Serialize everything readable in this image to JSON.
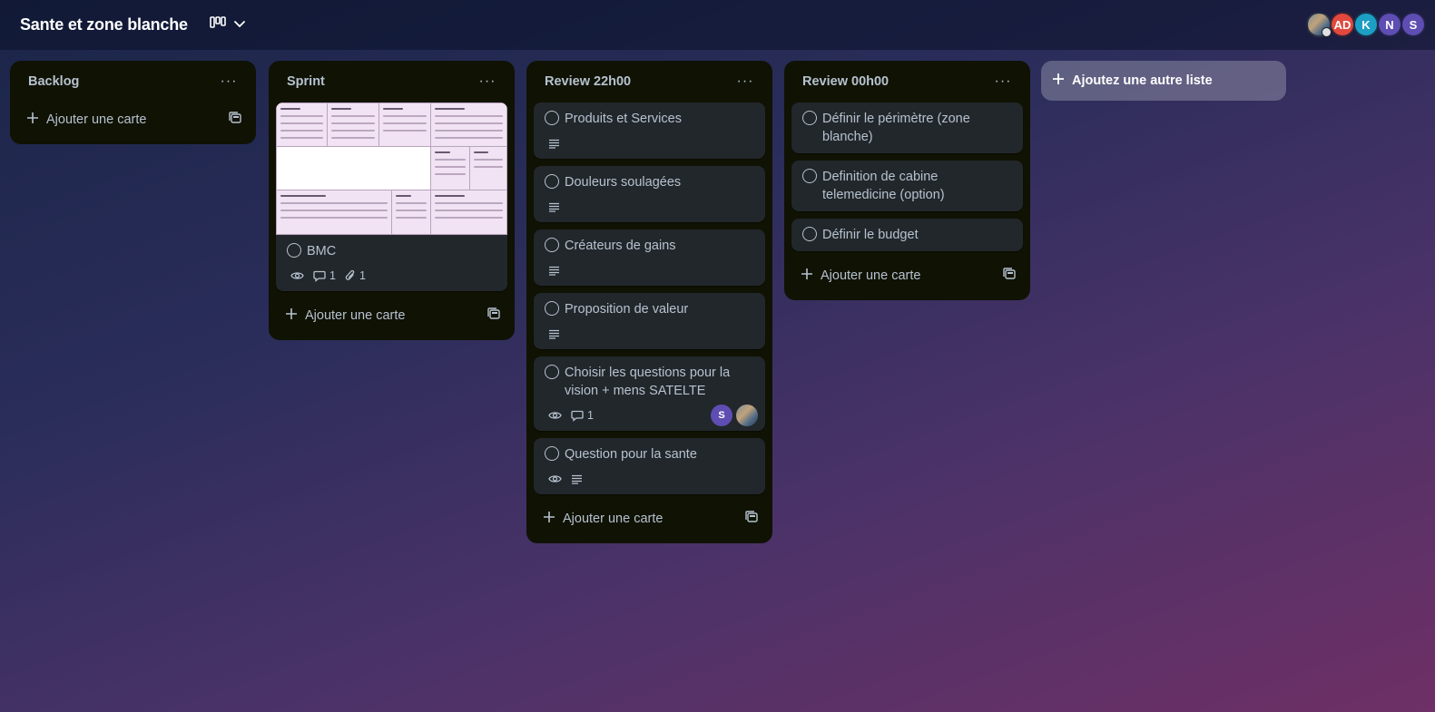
{
  "board": {
    "title": "Sante et zone blanche",
    "view_icon": "board-view-icon",
    "dropdown_icon": "chevron-down-icon"
  },
  "members": [
    {
      "initials": "",
      "color": "#6b7f8f",
      "photo": true
    },
    {
      "initials": "AD",
      "color": "#e2483d"
    },
    {
      "initials": "K",
      "color": "#1d9fc4"
    },
    {
      "initials": "N",
      "color": "#5e4db2"
    },
    {
      "initials": "S",
      "color": "#5e4db2"
    }
  ],
  "lists": [
    {
      "title": "Backlog",
      "menu": "···",
      "add_card_label": "Ajouter une carte",
      "cards": []
    },
    {
      "title": "Sprint",
      "menu": "···",
      "add_card_label": "Ajouter une carte",
      "cards": [
        {
          "title": "BMC",
          "comments": "1",
          "attachments": "1",
          "has_cover": true
        }
      ]
    },
    {
      "title": "Review 22h00",
      "menu": "···",
      "add_card_label": "Ajouter une carte",
      "cards": [
        {
          "title": "Produits et Services"
        },
        {
          "title": "Douleurs soulagées"
        },
        {
          "title": "Créateurs de gains"
        },
        {
          "title": "Proposition de valeur"
        },
        {
          "title": "Choisir les questions pour la vision + mens SATELTE",
          "comments": "1",
          "members": [
            "S"
          ]
        },
        {
          "title": "Question pour la sante"
        }
      ]
    },
    {
      "title": "Review 00h00",
      "menu": "···",
      "add_card_label": "Ajouter une carte",
      "cards": [
        {
          "title": "Définir le périmètre (zone blanche)"
        },
        {
          "title": "Definition de cabine telemedicine (option)"
        },
        {
          "title": "Définir le budget"
        }
      ]
    }
  ],
  "add_list_label": "Ajoutez une autre liste"
}
